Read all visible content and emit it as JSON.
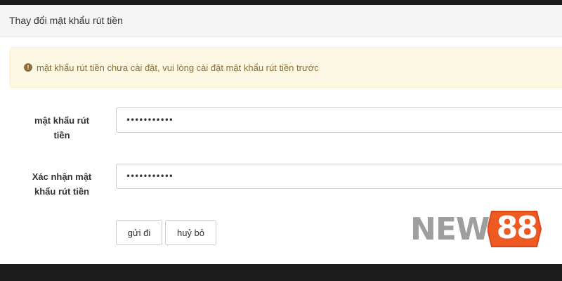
{
  "panel": {
    "title": "Thay đổi mật khẩu rút tiền"
  },
  "alert": {
    "icon": "exclamation-circle-icon",
    "message": "mật khẩu rút tiền chưa cài đặt, vui lòng cài đặt mật khẩu rút tiền trước",
    "color": "#8a6d3b",
    "background": "#fcf8e3"
  },
  "form": {
    "password_label_line1": "mật khẩu rút",
    "password_label_line2": "tiền",
    "password_value": "•••••••••••",
    "confirm_label_line1": "Xác nhận mật",
    "confirm_label_line2": "khẩu rút tiền",
    "confirm_value": "•••••••••••"
  },
  "buttons": {
    "submit_label": "gửi đi",
    "cancel_label": "huỷ bỏ"
  },
  "watermark": {
    "text_part1": "NEW",
    "text_part2": "88",
    "badge_color": "#ef5a23",
    "text_color": "#9e9e9e"
  }
}
